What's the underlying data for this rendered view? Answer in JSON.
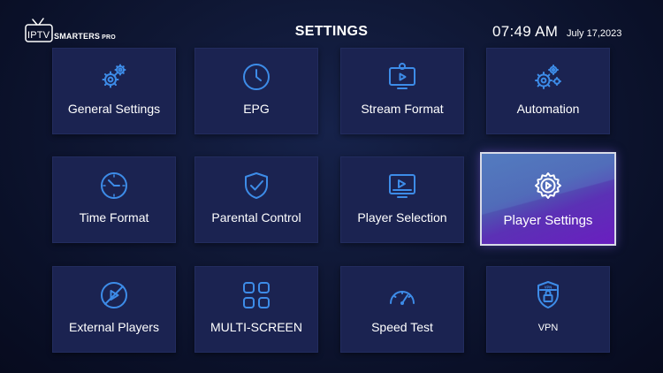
{
  "header": {
    "logo_iptv": "IPTV",
    "logo_brand": "SMARTERS",
    "logo_pro": "PRO",
    "title": "SETTINGS",
    "time": "07:49 AM",
    "date": "July 17,2023"
  },
  "tiles": [
    {
      "label": "General Settings",
      "icon": "gears-icon"
    },
    {
      "label": "EPG",
      "icon": "clock-icon"
    },
    {
      "label": "Stream Format",
      "icon": "stream-screen-icon"
    },
    {
      "label": "Automation",
      "icon": "automation-gears-icon"
    },
    {
      "label": "Time Format",
      "icon": "time-format-icon"
    },
    {
      "label": "Parental Control",
      "icon": "shield-check-icon"
    },
    {
      "label": "Player Selection",
      "icon": "player-screen-icon"
    },
    {
      "label": "Player Settings",
      "icon": "gear-play-icon",
      "selected": true
    },
    {
      "label": "External Players",
      "icon": "external-player-icon"
    },
    {
      "label": "MULTI-SCREEN",
      "icon": "grid-icon"
    },
    {
      "label": "Speed Test",
      "icon": "speedometer-icon"
    },
    {
      "label": "VPN",
      "icon": "vpn-shield-icon"
    }
  ],
  "colors": {
    "accent_icon": "#3d8ce8",
    "tile_bg": "#1b2351",
    "selected_gradient_start": "#4b72b4",
    "selected_gradient_end": "#6a1ec0"
  }
}
